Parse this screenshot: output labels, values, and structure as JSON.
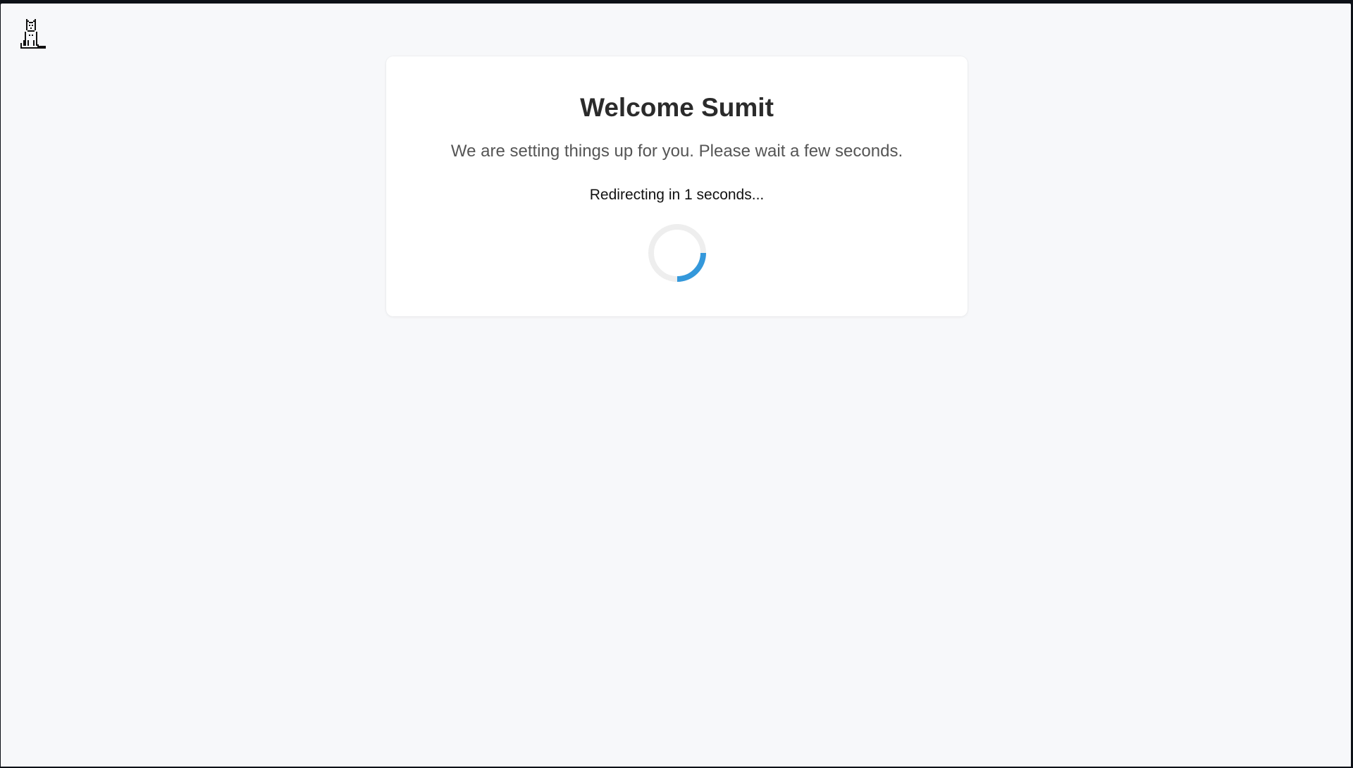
{
  "header": {
    "logo_icon": "pixel-cat-icon"
  },
  "card": {
    "title": "Welcome Sumit",
    "subtitle": "We are setting things up for you. Please wait a few seconds.",
    "redirect_text": "Redirecting in 1 seconds...",
    "spinner_icon": "loading-spinner-icon"
  },
  "colors": {
    "background": "#f7f8fa",
    "card": "#ffffff",
    "spinner_track": "#eeeeee",
    "spinner_accent": "#3498db"
  }
}
